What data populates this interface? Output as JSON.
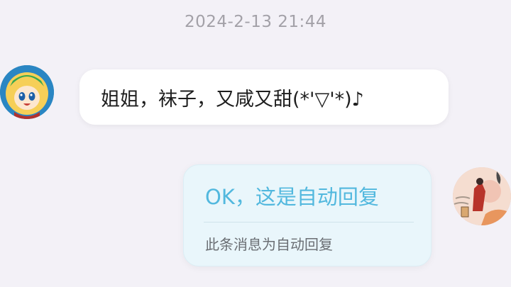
{
  "chat": {
    "timestamp": "2024-2-13 21:44",
    "messages": [
      {
        "side": "left",
        "text": "姐姐，袜子，又咸又甜(*'▽'*)♪",
        "avatar_icon": "cartoon-character-avatar"
      },
      {
        "side": "right",
        "text": "OK，这是自动回复",
        "note": "此条消息为自动回复",
        "avatar_icon": "ink-painting-avatar"
      }
    ]
  },
  "colors": {
    "background": "#f3f1f7",
    "timestamp": "#a3a1a8",
    "left_bubble": "#ffffff",
    "right_bubble": "#e9f6fb",
    "auto_reply_text": "#52b8de",
    "note_text": "#6a6e73"
  }
}
